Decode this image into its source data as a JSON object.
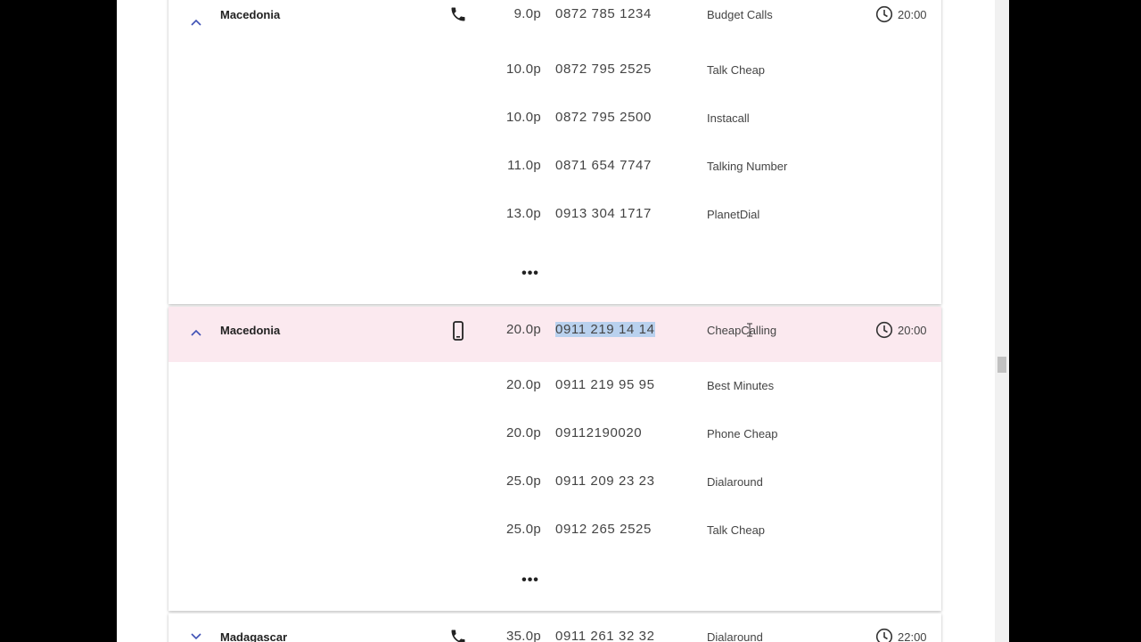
{
  "sections": [
    {
      "country": "Macedonia",
      "line_type": "landline",
      "expanded": true,
      "highlighted": false,
      "time": "20:00",
      "rates": [
        {
          "price": "9.0p",
          "number": "0872 785 1234",
          "provider": "Budget Calls"
        },
        {
          "price": "10.0p",
          "number": "0872 795 2525",
          "provider": "Talk Cheap"
        },
        {
          "price": "10.0p",
          "number": "0872 795 2500",
          "provider": "Instacall"
        },
        {
          "price": "11.0p",
          "number": "0871 654 7747",
          "provider": "Talking Number"
        },
        {
          "price": "13.0p",
          "number": "0913 304 1717",
          "provider": "PlanetDial"
        }
      ],
      "more_label": "•••"
    },
    {
      "country": "Macedonia",
      "line_type": "mobile",
      "expanded": true,
      "highlighted": true,
      "time": "20:00",
      "selected_number": "0911 219 14 14",
      "rates": [
        {
          "price": "20.0p",
          "number": "0911 219 14 14",
          "provider": "CheapCalling"
        },
        {
          "price": "20.0p",
          "number": "0911 219 95 95",
          "provider": "Best Minutes"
        },
        {
          "price": "20.0p",
          "number": "09112190020",
          "provider": "Phone Cheap"
        },
        {
          "price": "25.0p",
          "number": "0911 209 23 23",
          "provider": "Dialaround"
        },
        {
          "price": "25.0p",
          "number": "0912 265 2525",
          "provider": "Talk Cheap"
        }
      ],
      "more_label": "•••"
    },
    {
      "country": "Madagascar",
      "line_type": "landline",
      "expanded": false,
      "highlighted": false,
      "time": "22:00",
      "rates": [
        {
          "price": "35.0p",
          "number": "0911 261 32 32",
          "provider": "Dialaround"
        }
      ]
    }
  ],
  "icons": {
    "expand_open": "chevron-up-icon",
    "expand_closed": "chevron-down-icon",
    "landline": "phone-icon",
    "mobile": "mobile-phone-icon",
    "time": "clock-icon"
  },
  "colors": {
    "highlight_row": "#fbe9ef",
    "chevron": "#3f51b5",
    "selection": "#b9d1ee"
  }
}
